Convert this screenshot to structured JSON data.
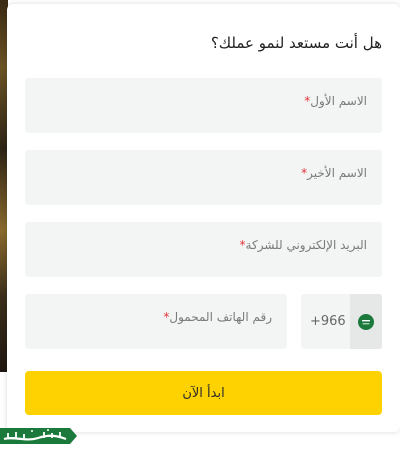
{
  "form": {
    "title": "هل أنت مستعد لنمو عملك؟",
    "fields": {
      "first_name": "الاسم الأول",
      "last_name": "الاسم الأخير",
      "email": "البريد الإلكتروني للشركة",
      "phone": "رقم الهاتف المحمول"
    },
    "required_mark": "*",
    "country_code": "+966",
    "submit_label": "ابدأ الآن"
  },
  "branding": {
    "logo_text": "سعودية العز"
  },
  "colors": {
    "submit_bg": "#fdd200",
    "field_bg": "#f3f4f4",
    "required": "#e0343a",
    "flag_green": "#1b7a3b"
  },
  "icons": {
    "country_flag": "saudi-flag-icon"
  }
}
